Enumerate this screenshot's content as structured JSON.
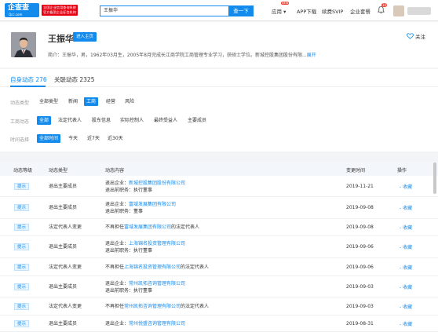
{
  "topbar": {
    "logo_text": "企查查",
    "logo_domain": "Qcc.com",
    "logo_sub1": "全国企业信用查询系统",
    "logo_sub2": "官方备案企业征信机构",
    "search_value": "王振华",
    "search_button": "查一下",
    "nav": [
      {
        "label": "应用 ▾"
      },
      {
        "label": "APP下载"
      },
      {
        "label": "续费SVIP"
      },
      {
        "label": "企业套餐"
      }
    ],
    "nav_hot": "NEW",
    "notif_count": "10"
  },
  "profile": {
    "name": "王振华",
    "enter_button": "进入主页",
    "follow": "关注",
    "bio": "简介：王振华，男，1962年03月生，2005年8月完成长江商学院工商管理专业学习，获硕士学位。新城控股集团股份有限...",
    "bio_more": "展开"
  },
  "dynamics": {
    "tabs": [
      {
        "label": "自身动态 276"
      },
      {
        "label": "关联动态 2325"
      }
    ],
    "filters": [
      {
        "label": "动态类型",
        "options": [
          "全部类型",
          "新闻",
          "工商",
          "经营",
          "风险"
        ],
        "active": 2
      },
      {
        "label": "工商动态",
        "options": [
          "全部",
          "法定代表人",
          "股东信息",
          "实际控制人",
          "最终受益人",
          "主要成员"
        ],
        "active": 0
      },
      {
        "label": "时间选择",
        "options": [
          "全部时间",
          "今天",
          "近7天",
          "近30天"
        ],
        "active": 0
      }
    ]
  },
  "table": {
    "headers": [
      "动态等级",
      "动态类型",
      "动态内容",
      "变更时间",
      "操作"
    ],
    "rows": [
      {
        "level": "提示",
        "type": "退出主要成员",
        "lines": [
          [
            "退出企业：",
            "新城控股集团股份有限公司"
          ],
          [
            "退出前职务：",
            "执行董事"
          ]
        ],
        "date": "2019-11-21",
        "op": "收藏"
      },
      {
        "level": "提示",
        "type": "退出主要成员",
        "lines": [
          [
            "退出企业：",
            "富域发展集团有限公司"
          ],
          [
            "退出前职务：",
            "董事"
          ]
        ],
        "date": "2019-09-08",
        "op": "收藏"
      },
      {
        "level": "提示",
        "type": "法定代表人变更",
        "lines": [
          [
            "不再担任",
            "富域发展集团有限公司",
            "的法定代表人"
          ]
        ],
        "date": "2019-09-08",
        "op": "收藏"
      },
      {
        "level": "提示",
        "type": "退出主要成员",
        "lines": [
          [
            "退出企业：",
            "上海锦名投资管理有限公司"
          ],
          [
            "退出前职务：",
            "执行董事"
          ]
        ],
        "date": "2019-09-06",
        "op": "收藏"
      },
      {
        "level": "提示",
        "type": "法定代表人变更",
        "lines": [
          [
            "不再担任",
            "上海锦名投资管理有限公司",
            "的法定代表人"
          ]
        ],
        "date": "2019-09-06",
        "op": "收藏"
      },
      {
        "level": "提示",
        "type": "退出主要成员",
        "lines": [
          [
            "退出企业：",
            "常州凯拓咨询管理有限公司"
          ],
          [
            "退出前职务：",
            "执行董事"
          ]
        ],
        "date": "2019-09-03",
        "op": "收藏"
      },
      {
        "level": "提示",
        "type": "法定代表人变更",
        "lines": [
          [
            "不再担任",
            "常州凯拓咨询管理有限公司",
            "的法定代表人"
          ]
        ],
        "date": "2019-09-03",
        "op": "收藏"
      },
      {
        "level": "提示",
        "type": "退出主要成员",
        "lines": [
          [
            "退出企业：",
            "常州悦盛咨询管理有限公司"
          ]
        ],
        "date": "2019-08-31",
        "op": "收藏"
      }
    ]
  },
  "colors": {
    "accent": "#128bed",
    "brand_red": "#e60012"
  }
}
